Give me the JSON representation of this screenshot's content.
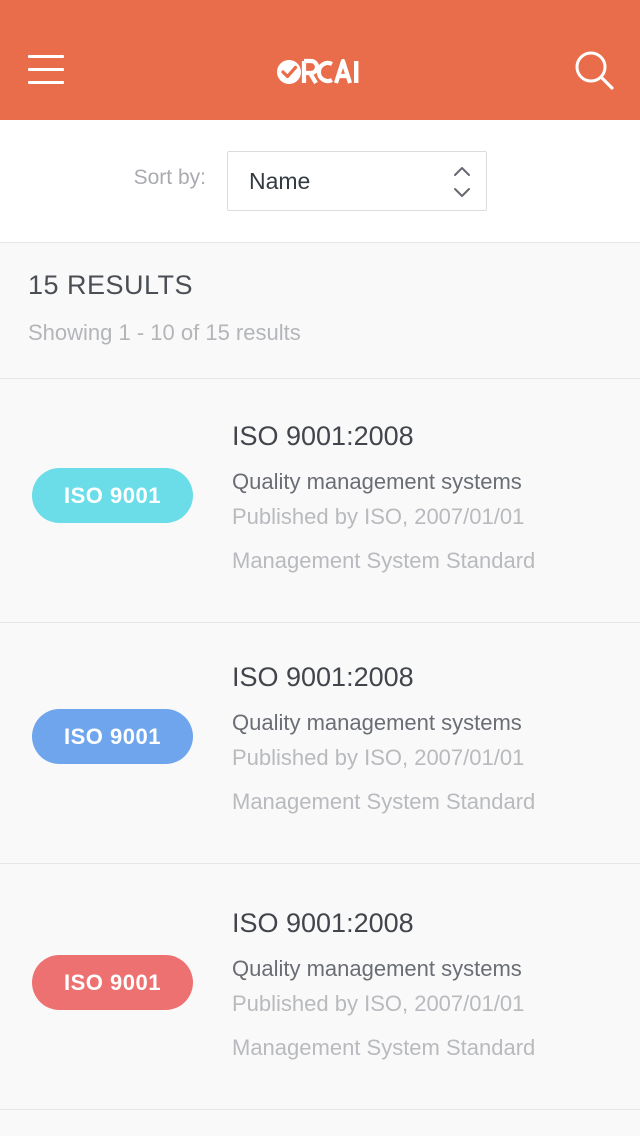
{
  "header": {
    "logo_text": "ORCAI",
    "accent_color": "#e96d4a",
    "menu_icon": "hamburger-icon",
    "search_icon": "search-icon"
  },
  "sort": {
    "label": "Sort by:",
    "selected": "Name"
  },
  "results": {
    "count_label": "15 RESULTS",
    "showing_label": "Showing 1 - 10 of 15 results"
  },
  "items": [
    {
      "badge": "ISO 9001",
      "badge_color": "#6bdde8",
      "title": "ISO 9001:2008",
      "subtitle": "Quality management systems",
      "published": "Published by ISO, 2007/01/01",
      "type": "Management System Standard"
    },
    {
      "badge": "ISO 9001",
      "badge_color": "#6fa5ec",
      "title": "ISO 9001:2008",
      "subtitle": "Quality management systems",
      "published": "Published by ISO, 2007/01/01",
      "type": "Management System Standard"
    },
    {
      "badge": "ISO 9001",
      "badge_color": "#ee7171",
      "title": "ISO 9001:2008",
      "subtitle": "Quality management systems",
      "published": "Published by ISO, 2007/01/01",
      "type": "Management System Standard"
    }
  ]
}
